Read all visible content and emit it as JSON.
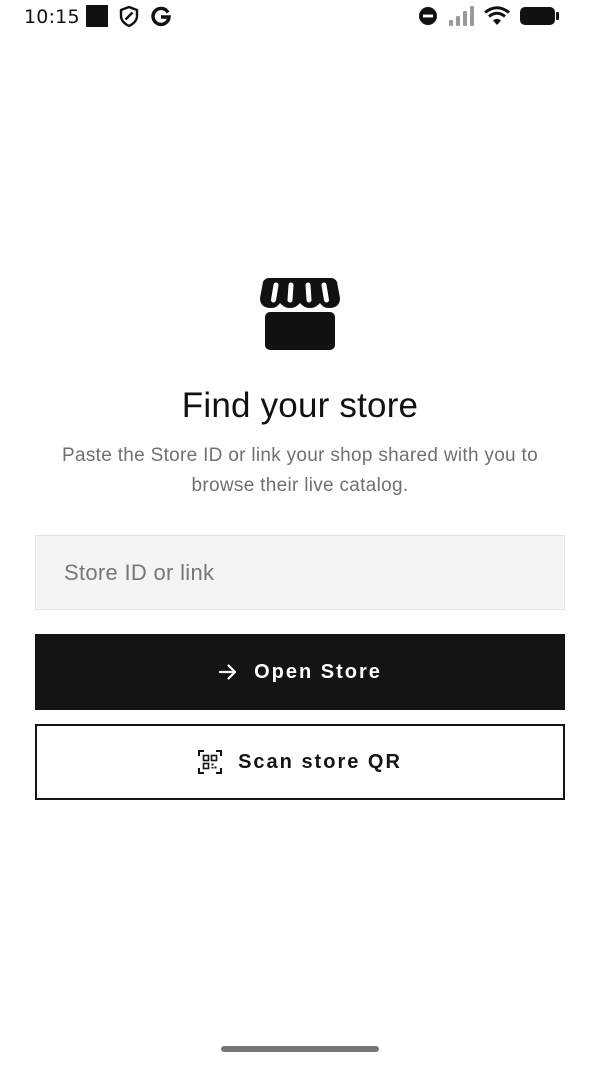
{
  "status_bar": {
    "time": "10:15",
    "left_icons": [
      "square-notification-icon",
      "shield-icon",
      "google-icon"
    ],
    "right_icons": [
      "do-not-disturb-icon",
      "signal-icon",
      "wifi-icon",
      "battery-icon"
    ]
  },
  "main": {
    "store_icon": "storefront-icon",
    "title": "Find your store",
    "subtitle": "Paste the Store ID or link your shop shared with you to browse their live catalog.",
    "input": {
      "placeholder": "Store ID or link",
      "value": ""
    },
    "open_button": {
      "label": "Open Store",
      "icon": "arrow-right-icon"
    },
    "scan_button": {
      "label": "Scan store QR",
      "icon": "qr-scan-icon"
    }
  },
  "colors": {
    "primary": "#141414",
    "background": "#ffffff",
    "muted_text": "#707070",
    "input_bg": "#f4f4f4"
  }
}
